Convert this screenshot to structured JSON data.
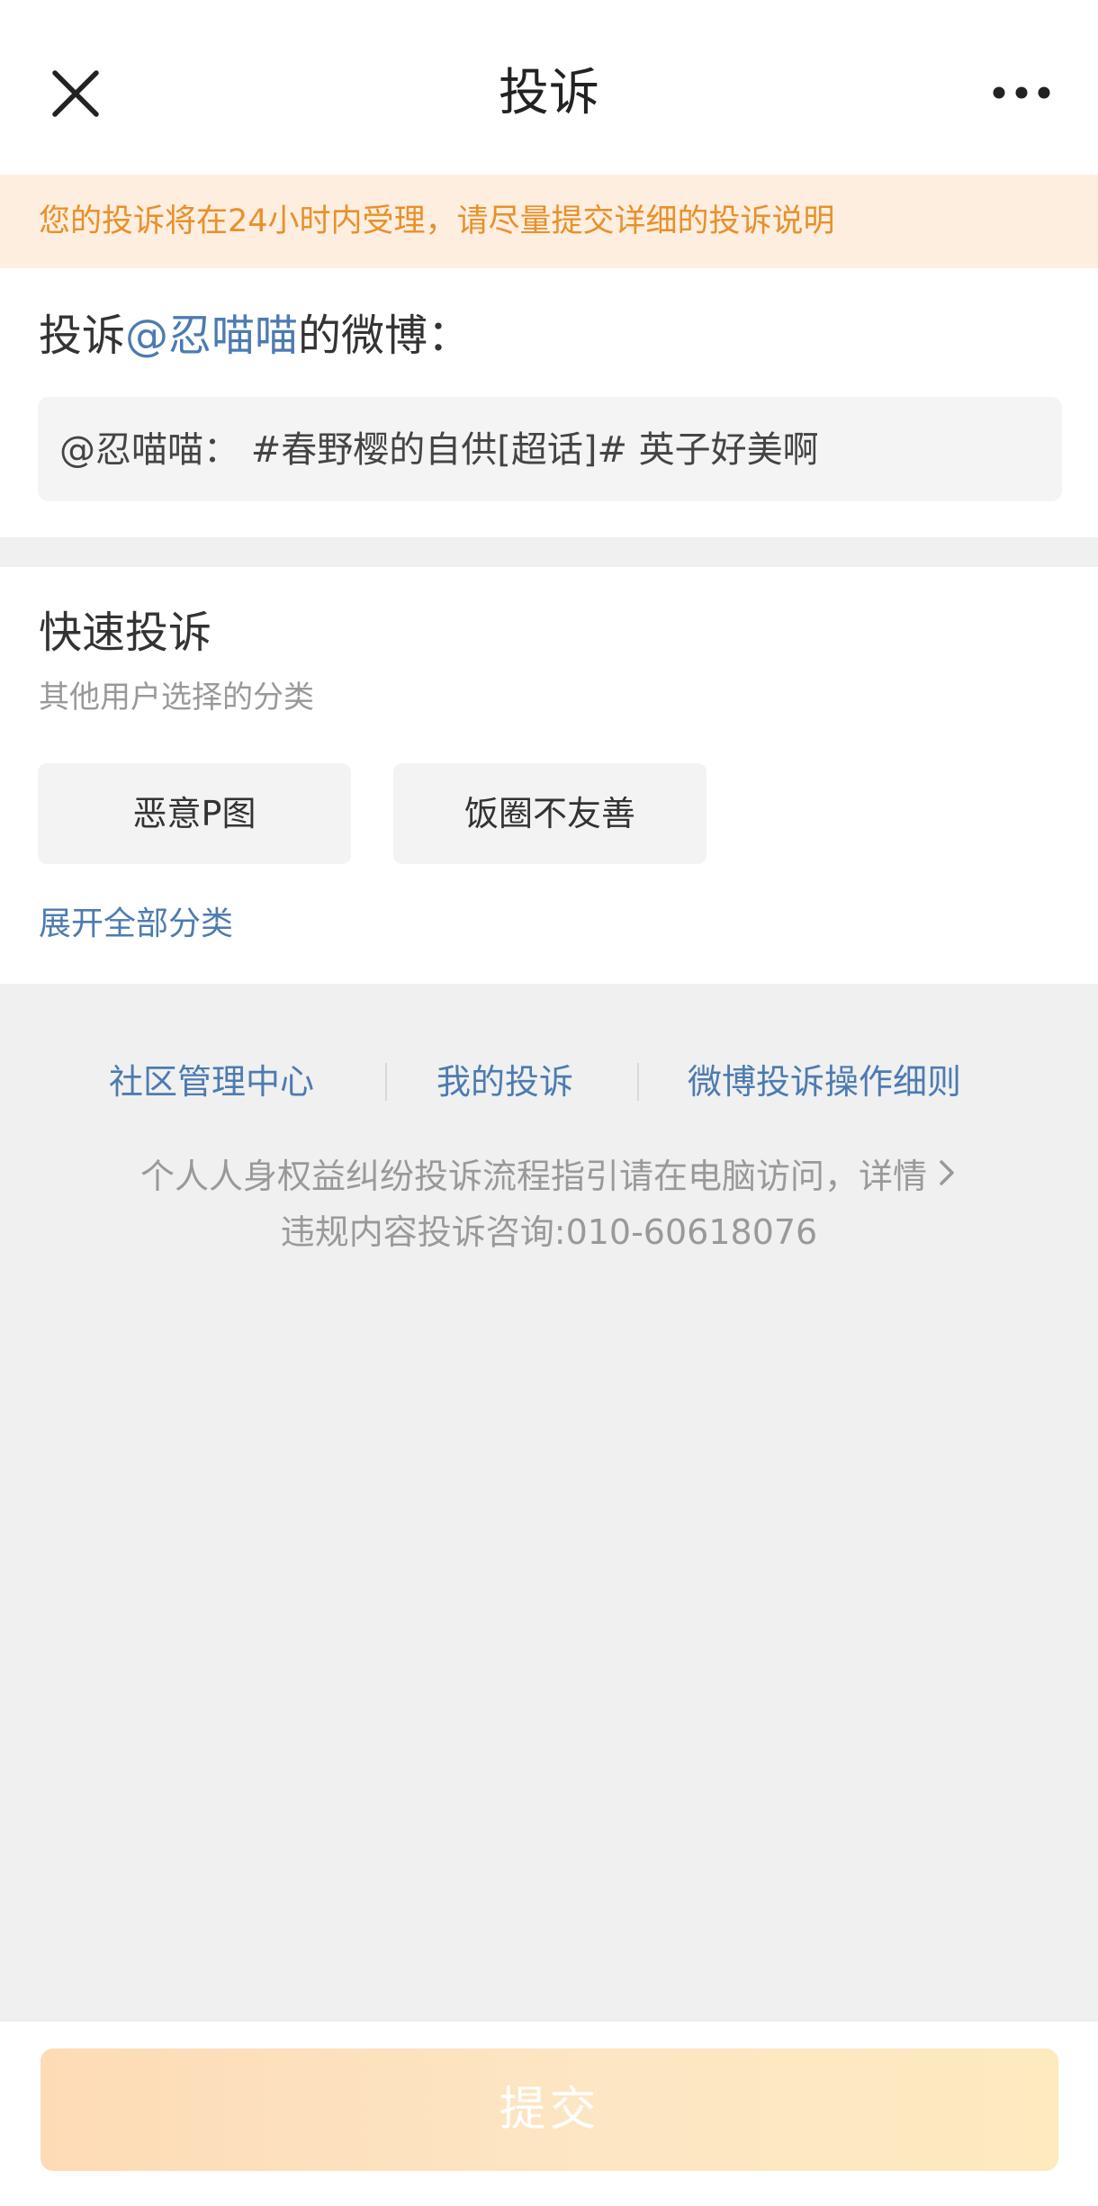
{
  "header": {
    "title": "投诉",
    "close_icon": "close-icon",
    "more_icon": "more-icon"
  },
  "notice": {
    "text": "您的投诉将在24小时内受理，请尽量提交详细的投诉说明",
    "color": "#e8902a",
    "background": "#fdeee0"
  },
  "target": {
    "prefix": "投诉",
    "mention": "@忍喵喵",
    "suffix": "的微博：",
    "quote": "@忍喵喵：  #春野樱的自供[超话]#  英子好美啊",
    "mention_color": "#4d7bb0"
  },
  "quick": {
    "title": "快速投诉",
    "subtitle": "其他用户选择的分类",
    "categories": [
      "恶意P图",
      "饭圈不友善"
    ],
    "expand_label": "展开全部分类"
  },
  "footer": {
    "links": [
      "社区管理中心",
      "我的投诉",
      "微博投诉操作细则"
    ],
    "guide": "个人人身权益纠纷投诉流程指引请在电脑访问，详情",
    "guide_icon": "chevron-right-icon",
    "hotline": "违规内容投诉咨询:010-60618076"
  },
  "submit": {
    "label": "提交",
    "state": "disabled"
  }
}
